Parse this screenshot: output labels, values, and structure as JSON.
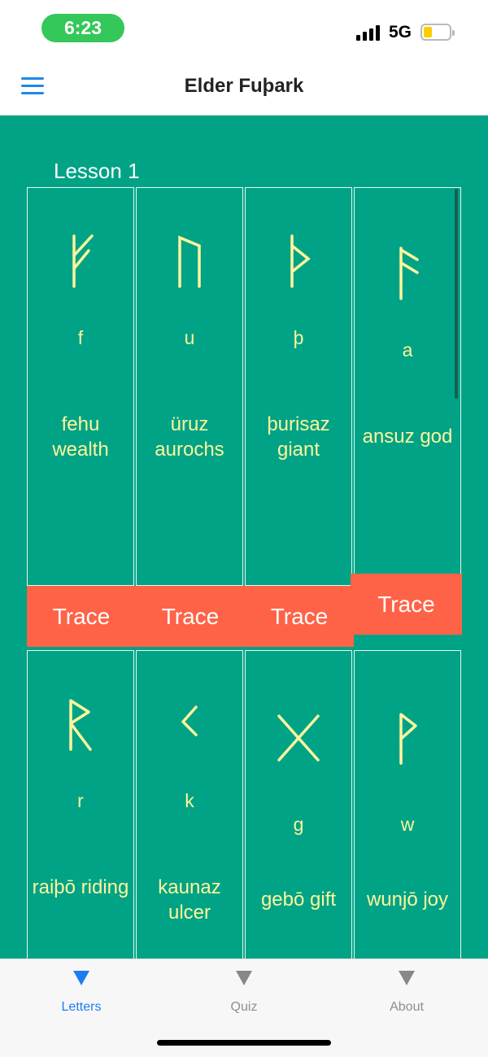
{
  "status": {
    "time": "6:23",
    "network": "5G"
  },
  "nav": {
    "title": "Elder Fuþark"
  },
  "lesson": {
    "title": "Lesson 1"
  },
  "cards": [
    {
      "rune": "fehu-rune",
      "latin": "f",
      "meaning": "fehu wealth",
      "button": "Trace"
    },
    {
      "rune": "uruz-rune",
      "latin": "u",
      "meaning": "üruz aurochs",
      "button": "Trace"
    },
    {
      "rune": "thurisaz-rune",
      "latin": "þ",
      "meaning": "þurisaz giant",
      "button": "Trace"
    },
    {
      "rune": "ansuz-rune",
      "latin": "a",
      "meaning": "ansuz god",
      "button": "Trace"
    },
    {
      "rune": "raidho-rune",
      "latin": "r",
      "meaning": "raiþō riding"
    },
    {
      "rune": "kaunaz-rune",
      "latin": "k",
      "meaning": "kaunaz ulcer"
    },
    {
      "rune": "gebo-rune",
      "latin": "g",
      "meaning": "gebō gift"
    },
    {
      "rune": "wunjo-rune",
      "latin": "w",
      "meaning": "wunjō joy"
    }
  ],
  "tabs": [
    {
      "label": "Letters",
      "active": true
    },
    {
      "label": "Quiz",
      "active": false
    },
    {
      "label": "About",
      "active": false
    }
  ],
  "colors": {
    "background": "#00a386",
    "button": "#ff6347",
    "runeText": "#fff59d",
    "accent": "#1e7cf0"
  }
}
